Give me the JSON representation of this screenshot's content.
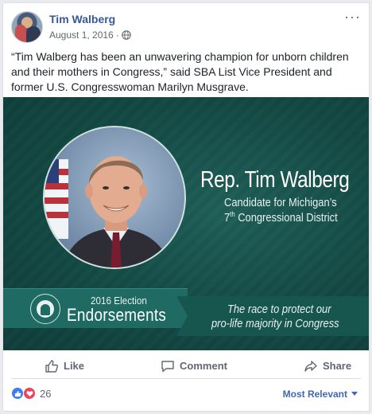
{
  "post": {
    "author": "Tim Walberg",
    "date": "August 1, 2016",
    "separator": "·",
    "more_label": "···",
    "text": "“Tim Walberg has been an unwavering champion for unborn children and their mothers in Congress,” said SBA List Vice President and former U.S. Congresswoman Marilyn Musgrave."
  },
  "graphic": {
    "name": "Rep. Tim Walberg",
    "subtitle_line1": "Candidate for Michigan’s",
    "subtitle_line2_num": "7",
    "subtitle_line2_sup": "th",
    "subtitle_line2_rest": " Congressional District",
    "banner_year": "2016 Election",
    "banner_title": "Endorsements",
    "slogan_line1": "The race to protect our",
    "slogan_line2": "pro-life majority in Congress",
    "colors": {
      "background": "#134843",
      "banner": "#1f6b63",
      "text": "#ffffff"
    }
  },
  "actions": {
    "like": "Like",
    "comment": "Comment",
    "share": "Share"
  },
  "reactions": {
    "count": "26",
    "icons": [
      "like-reaction-icon",
      "love-reaction-icon"
    ],
    "sort_label": "Most Relevant"
  },
  "colors": {
    "link": "#385898",
    "secondary_text": "#606770",
    "sort_link": "#4267b2"
  }
}
